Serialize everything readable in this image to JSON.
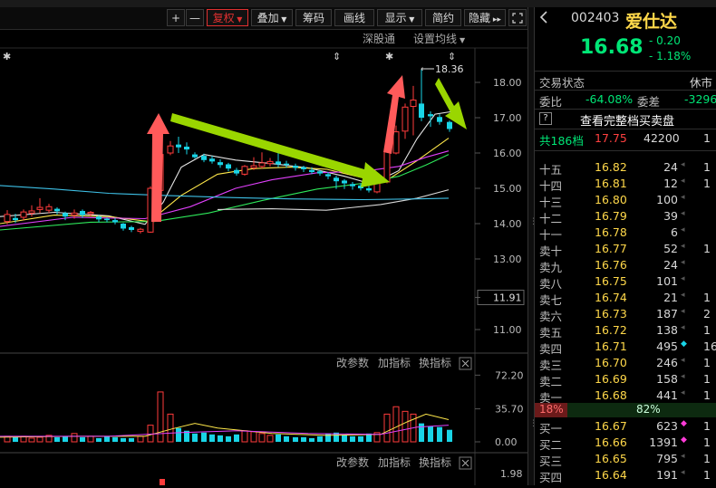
{
  "toolbar": {
    "plus": "+",
    "minus": "—",
    "fuquan": "复权",
    "diejia": "叠加",
    "chouma": "筹码",
    "huaxian": "画线",
    "xianshi": "显示",
    "jianyue": "简约",
    "yincang": "隐藏",
    "subtoolbar_sgt": "深股通",
    "subtoolbar_ma": "设置均线"
  },
  "price_chart": {
    "y_ticks": [
      "18.00",
      "17.00",
      "16.00",
      "15.00",
      "14.00",
      "13.00",
      "11.91",
      "11.00"
    ],
    "max_label": "18.36"
  },
  "volume_pane": {
    "btn_param": "改参数",
    "btn_add": "加指标",
    "btn_switch": "换指标",
    "y_ticks": [
      "72.20",
      "35.70",
      "0.00"
    ]
  },
  "third_pane": {
    "btn_param": "改参数",
    "btn_add": "加指标",
    "btn_switch": "换指标",
    "y_tick": "1.98"
  },
  "stock": {
    "code": "002403",
    "name": "爱仕达",
    "price": "16.68",
    "change": "- 0.20",
    "change_pct": "- 1.18%",
    "trade_status_label": "交易状态",
    "trade_status_value": "休市",
    "weibi_label": "委比",
    "weibi_value": "-64.08%",
    "weicha_label": "委差",
    "weicha_value": "-3296",
    "help_icon": "?",
    "full_book_link": "查看完整档买卖盘",
    "depth_label": "共186档",
    "depth_price": "17.75",
    "depth_vol": "42200",
    "depth_ext": "1"
  },
  "asks": [
    {
      "label": "十五",
      "price": "16.82",
      "vol": "24",
      "ext": "1"
    },
    {
      "label": "十四",
      "price": "16.81",
      "vol": "12",
      "ext": "1"
    },
    {
      "label": "十三",
      "price": "16.80",
      "vol": "100",
      "ext": ""
    },
    {
      "label": "十二",
      "price": "16.79",
      "vol": "39",
      "ext": ""
    },
    {
      "label": "十一",
      "price": "16.78",
      "vol": "6",
      "ext": ""
    },
    {
      "label": "卖十",
      "price": "16.77",
      "vol": "52",
      "ext": "1"
    },
    {
      "label": "卖九",
      "price": "16.76",
      "vol": "24",
      "ext": ""
    },
    {
      "label": "卖八",
      "price": "16.75",
      "vol": "101",
      "ext": ""
    },
    {
      "label": "卖七",
      "price": "16.74",
      "vol": "21",
      "ext": "1"
    },
    {
      "label": "卖六",
      "price": "16.73",
      "vol": "187",
      "ext": "2"
    },
    {
      "label": "卖五",
      "price": "16.72",
      "vol": "138",
      "ext": "1"
    },
    {
      "label": "卖四",
      "price": "16.71",
      "vol": "495",
      "ext": "16"
    },
    {
      "label": "卖三",
      "price": "16.70",
      "vol": "246",
      "ext": "1"
    },
    {
      "label": "卖二",
      "price": "16.69",
      "vol": "158",
      "ext": "1"
    },
    {
      "label": "卖一",
      "price": "16.68",
      "vol": "441",
      "ext": "1"
    }
  ],
  "ratio": {
    "left": "18%",
    "right": "82%"
  },
  "bids": [
    {
      "label": "买一",
      "price": "16.67",
      "vol": "623",
      "ext": "1"
    },
    {
      "label": "买二",
      "price": "16.66",
      "vol": "1391",
      "ext": "1"
    },
    {
      "label": "买三",
      "price": "16.65",
      "vol": "795",
      "ext": "1"
    },
    {
      "label": "买四",
      "price": "16.64",
      "vol": "191",
      "ext": "1"
    }
  ],
  "colors": {
    "up": "#ff3b3b",
    "down": "#19d4e6",
    "green_text": "#00e676",
    "yellow_text": "#ffd84a",
    "arrow_red": "#ff5a5a",
    "arrow_green": "#9ad600"
  }
}
